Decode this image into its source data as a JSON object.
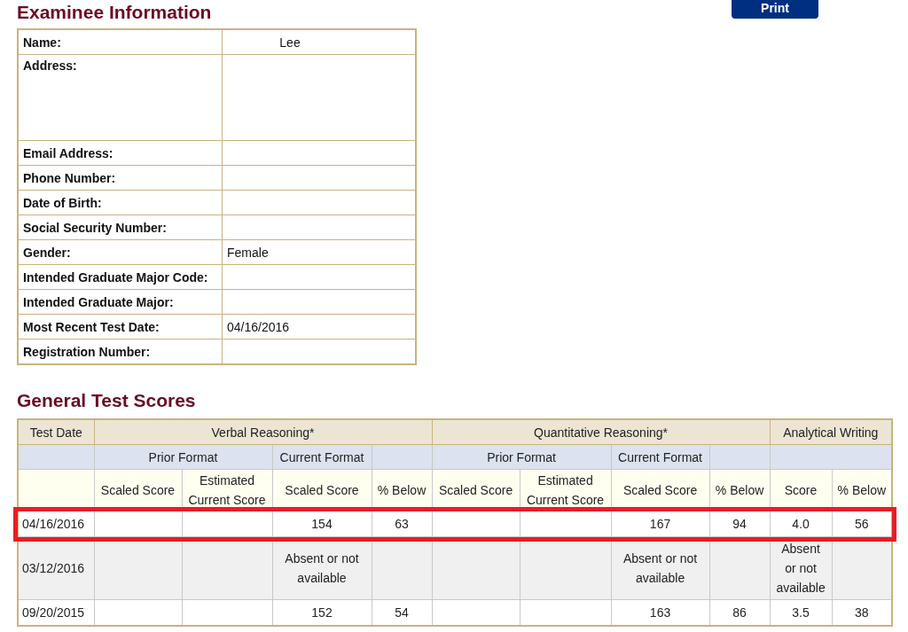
{
  "print_button": "Print",
  "examinee": {
    "title": "Examinee Information",
    "fields": [
      {
        "label": "Name:",
        "value": "Lee",
        "kind": "centered"
      },
      {
        "label": "Address:",
        "kind": "tall"
      },
      {
        "label": "Email Address:",
        "kind": "plain"
      },
      {
        "label": "Phone Number:",
        "kind": "plain"
      },
      {
        "label": "Date of Birth:",
        "kind": "plain"
      },
      {
        "label": "Social Security Number:",
        "kind": "plain"
      },
      {
        "label": "Gender:",
        "value": "Female",
        "kind": "plain"
      },
      {
        "label": "Intended Graduate Major Code:",
        "kind": "plain"
      },
      {
        "label": "Intended Graduate Major:",
        "kind": "plain"
      },
      {
        "label": "Most Recent Test Date:",
        "value": "04/16/2016",
        "kind": "plain"
      },
      {
        "label": "Registration Number:",
        "kind": "plain"
      }
    ]
  },
  "scores": {
    "title": "General Test Scores",
    "test_date_header": "Test Date",
    "sections": [
      {
        "title": "Verbal Reasoning*",
        "formats": [
          "Prior Format",
          "Current Format"
        ],
        "columns": [
          "Scaled Score",
          "Estimated Current Score",
          "Scaled Score",
          "% Below"
        ]
      },
      {
        "title": "Quantitative Reasoning*",
        "formats": [
          "Prior Format",
          "Current Format"
        ],
        "columns": [
          "Scaled Score",
          "Estimated Current Score",
          "Scaled Score",
          "% Below"
        ]
      },
      {
        "title": "Analytical Writing",
        "columns": [
          "Score",
          "% Below"
        ]
      }
    ],
    "rows": [
      {
        "date": "04/16/2016",
        "kind": "score",
        "highlighted": true,
        "cells": [
          null,
          null,
          "154",
          "63",
          null,
          null,
          "167",
          "94",
          "4.0",
          "56"
        ]
      },
      {
        "date": "03/12/2016",
        "kind": "absent",
        "highlighted": false,
        "cells": [
          null,
          null,
          "Absent or not available",
          null,
          null,
          null,
          "Absent or not available",
          null,
          "Absent or not available",
          null
        ]
      },
      {
        "date": "09/20/2015",
        "kind": "score",
        "highlighted": false,
        "cells": [
          null,
          null,
          "152",
          "54",
          null,
          null,
          "163",
          "86",
          "3.5",
          "38"
        ]
      }
    ]
  }
}
